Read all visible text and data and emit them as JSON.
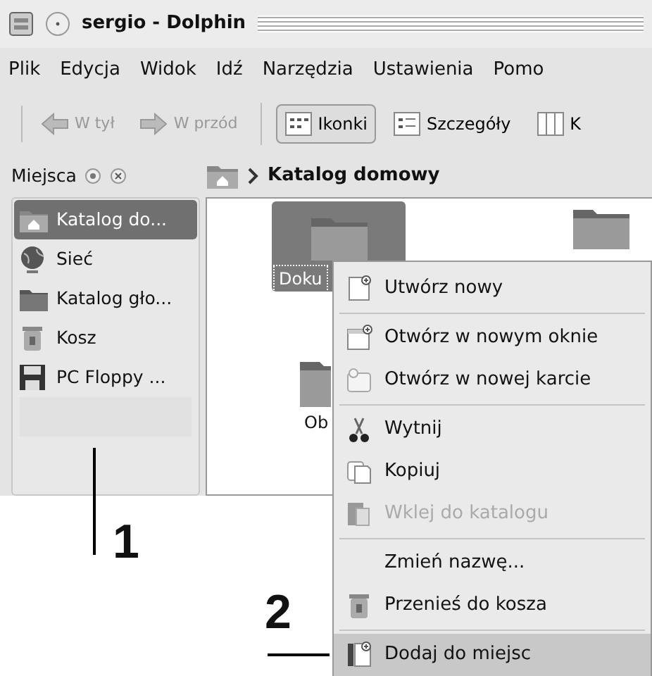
{
  "window": {
    "title": "sergio - Dolphin"
  },
  "menu_bar": [
    "Plik",
    "Edycja",
    "Widok",
    "Idź",
    "Narzędzia",
    "Ustawienia",
    "Pomo"
  ],
  "toolbar": [
    {
      "label": "W tył",
      "kind": "back",
      "disabled": true
    },
    {
      "label": "W przód",
      "kind": "forward",
      "disabled": true
    },
    {
      "label": "Ikonki",
      "kind": "icons",
      "selected": true
    },
    {
      "label": "Szczegóły",
      "kind": "details",
      "selected": false
    },
    {
      "label": "K",
      "kind": "columns",
      "selected": false
    }
  ],
  "places": {
    "title": "Miejsca",
    "items": [
      {
        "label": "Katalog do...",
        "kind": "home",
        "selected": true
      },
      {
        "label": "Sieć",
        "kind": "network",
        "selected": false
      },
      {
        "label": "Katalog gło...",
        "kind": "folder",
        "selected": false
      },
      {
        "label": "Kosz",
        "kind": "trash",
        "selected": false
      },
      {
        "label": "PC Floppy ...",
        "kind": "floppy",
        "selected": false
      }
    ]
  },
  "breadcrumb": "Katalog domowy",
  "files": [
    {
      "label": "Doku",
      "selected": true
    },
    {
      "label": "Ob",
      "selected": false
    }
  ],
  "context_menu": [
    {
      "kind": "new",
      "label": "Utwórz nowy",
      "disabled": false,
      "selected": false
    },
    {
      "kind": "separator"
    },
    {
      "kind": "window",
      "label": "Otwórz w nowym oknie",
      "disabled": false,
      "selected": false
    },
    {
      "kind": "tab",
      "label": "Otwórz w nowej karcie",
      "disabled": false,
      "selected": false
    },
    {
      "kind": "separator"
    },
    {
      "kind": "cut",
      "label": "Wytnij",
      "disabled": false,
      "selected": false
    },
    {
      "kind": "copy",
      "label": "Kopiuj",
      "disabled": false,
      "selected": false
    },
    {
      "kind": "paste",
      "label": "Wklej do katalogu",
      "disabled": true,
      "selected": false
    },
    {
      "kind": "separator"
    },
    {
      "kind": "rename",
      "label": "Zmień nazwę...",
      "disabled": false,
      "selected": false
    },
    {
      "kind": "trash",
      "label": "Przenieś do kosza",
      "disabled": false,
      "selected": false
    },
    {
      "kind": "separator"
    },
    {
      "kind": "bookmark",
      "label": "Dodaj do miejsc",
      "disabled": false,
      "selected": true
    }
  ],
  "annotations": [
    "1",
    "2"
  ]
}
